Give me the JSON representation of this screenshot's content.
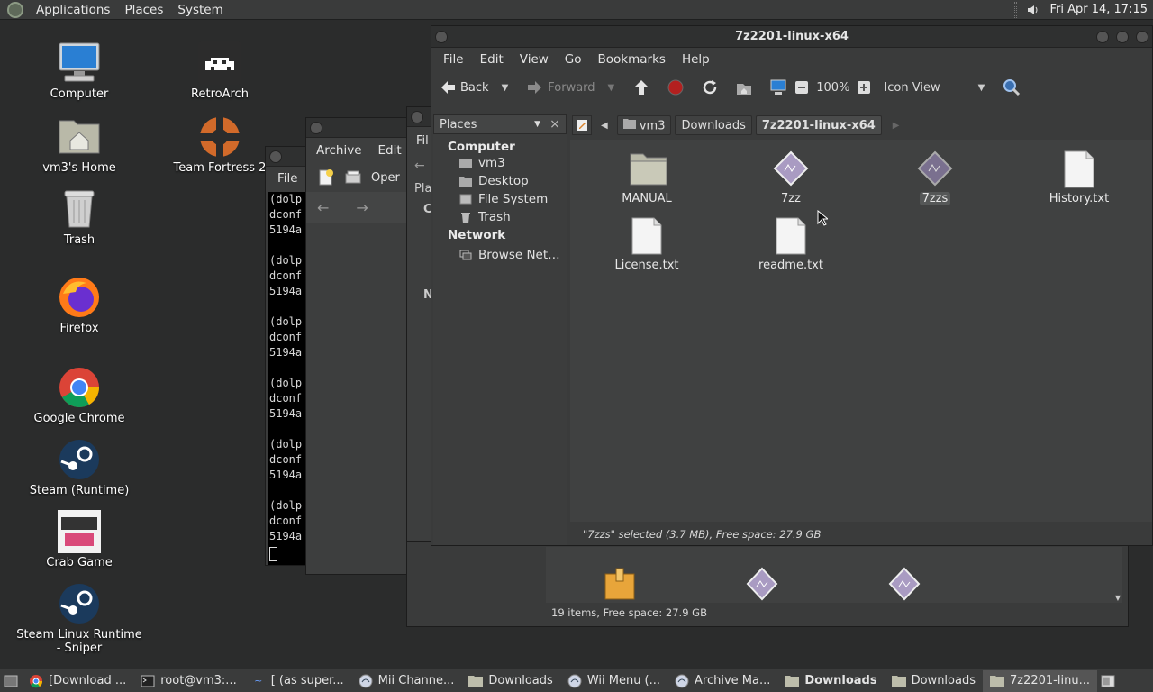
{
  "top_panel": {
    "menus": [
      "Applications",
      "Places",
      "System"
    ],
    "clock": "Fri Apr 14, 17:15"
  },
  "desktop": {
    "icons": [
      {
        "label": "Computer"
      },
      {
        "label": "vm3's Home"
      },
      {
        "label": "Trash"
      },
      {
        "label": "Firefox"
      },
      {
        "label": "Google Chrome"
      },
      {
        "label": "Steam (Runtime)"
      },
      {
        "label": "Crab Game"
      },
      {
        "label": "Steam Linux Runtime - Sniper"
      },
      {
        "label": "RetroArch"
      },
      {
        "label": "Team Fortress 2"
      }
    ]
  },
  "terminal": {
    "menu": "File",
    "lines": [
      "(dolp",
      "dconf",
      "5194a",
      "",
      "(dolp",
      "dconf",
      "5194a",
      "",
      "(dolp",
      "dconf",
      "5194a",
      "",
      "(dolp",
      "dconf",
      "5194a",
      "",
      "(dolp",
      "dconf",
      "5194a",
      "",
      "(dolp",
      "dconf",
      "5194a"
    ]
  },
  "archive_window": {
    "menus": [
      "Archive",
      "Edit"
    ],
    "open_label": "Oper"
  },
  "middle_window": {
    "menu": "Fil",
    "places": "Pla",
    "c": "C",
    "n": "N"
  },
  "main_window": {
    "title": "7z2201-linux-x64",
    "menus": [
      "File",
      "Edit",
      "View",
      "Go",
      "Bookmarks",
      "Help"
    ],
    "toolbar": {
      "back": "Back",
      "forward": "Forward",
      "zoom": "100%",
      "view_mode": "Icon View"
    },
    "sidebar": {
      "header": "Places",
      "sections": [
        {
          "title": "Computer",
          "items": [
            "vm3",
            "Desktop",
            "File System",
            "Trash"
          ]
        },
        {
          "title": "Network",
          "items": [
            "Browse Net…"
          ]
        }
      ]
    },
    "breadcrumbs": [
      "vm3",
      "Downloads",
      "7z2201-linux-x64"
    ],
    "files": [
      "MANUAL",
      "7zz",
      "7zzs",
      "History.txt",
      "License.txt",
      "readme.txt"
    ],
    "status": "\"7zzs\" selected (3.7 MB), Free space: 27.9 GB"
  },
  "lower_window": {
    "status": "19 items, Free space: 27.9 GB"
  },
  "taskbar": {
    "tasks": [
      "[Download ...",
      "root@vm3:...",
      "[ (as super...",
      "Mii Channe...",
      "Downloads",
      "Wii Menu (...",
      "Archive Ma...",
      "Downloads",
      "Downloads",
      "7z2201-linu..."
    ]
  }
}
